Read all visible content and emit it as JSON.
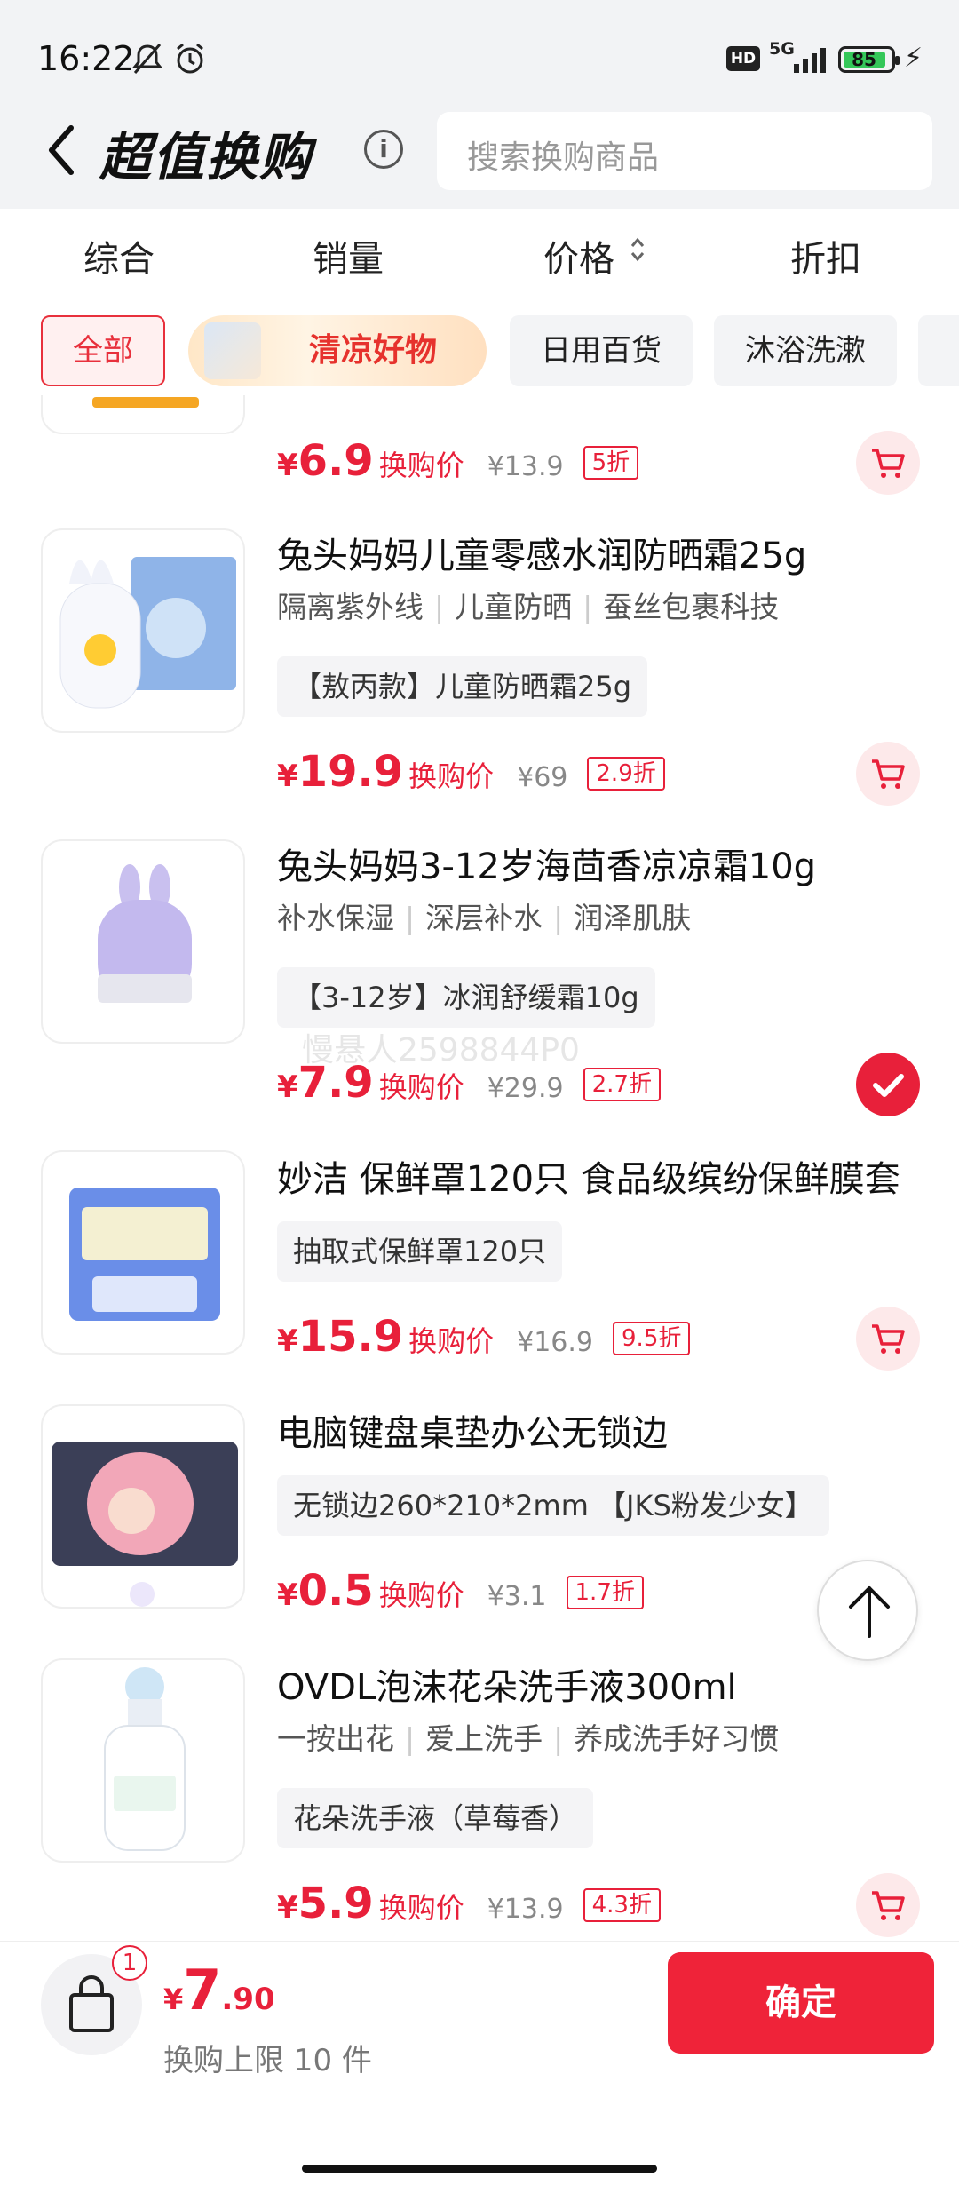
{
  "status": {
    "time": "16:22",
    "hd": "HD",
    "network": "5G",
    "battery": "85"
  },
  "header": {
    "title": "超值换购",
    "info_icon": "i",
    "search_placeholder": "搜索换购商品"
  },
  "sort_tabs": [
    "综合",
    "销量",
    "价格",
    "折扣"
  ],
  "chips": {
    "all": "全部",
    "promo": "清凉好物",
    "daily": "日用百货",
    "bath": "沐浴洗漱"
  },
  "products": [
    {
      "name": "",
      "tags": [],
      "spec": "",
      "currency": "¥",
      "price": "6.9",
      "price_label": "换购价",
      "orig": "¥13.9",
      "discount": "5折",
      "selected": false
    },
    {
      "name": "兔头妈妈儿童零感水润防晒霜25g",
      "tags": [
        "隔离紫外线",
        "儿童防晒",
        "蚕丝包裹科技"
      ],
      "spec": "【敖丙款】儿童防晒霜25g",
      "currency": "¥",
      "price": "19.9",
      "price_label": "换购价",
      "orig": "¥69",
      "discount": "2.9折",
      "selected": false
    },
    {
      "name": "兔头妈妈3-12岁海茴香凉凉霜10g",
      "tags": [
        "补水保湿",
        "深层补水",
        "润泽肌肤"
      ],
      "spec": "【3-12岁】冰润舒缓霜10g",
      "currency": "¥",
      "price": "7.9",
      "price_label": "换购价",
      "orig": "¥29.9",
      "discount": "2.7折",
      "selected": true
    },
    {
      "name": "妙洁 保鲜罩120只 食品级缤纷保鲜膜套",
      "tags": [],
      "spec": "抽取式保鲜罩120只",
      "currency": "¥",
      "price": "15.9",
      "price_label": "换购价",
      "orig": "¥16.9",
      "discount": "9.5折",
      "selected": false
    },
    {
      "name": "电脑键盘桌垫办公无锁边",
      "tags": [],
      "spec": "无锁边260*210*2mm 【JKS粉发少女】",
      "currency": "¥",
      "price": "0.5",
      "price_label": "换购价",
      "orig": "¥3.1",
      "discount": "1.7折",
      "selected": false
    },
    {
      "name": "OVDL泡沫花朵洗手液300ml",
      "tags": [
        "一按出花",
        "爱上洗手",
        "养成洗手好习惯"
      ],
      "spec": "花朵洗手液（草莓香）",
      "currency": "¥",
      "price": "5.9",
      "price_label": "换购价",
      "orig": "¥13.9",
      "discount": "4.3折",
      "selected": false
    }
  ],
  "watermark": "慢悬人2598844P0",
  "bottom": {
    "badge": "1",
    "currency": "¥",
    "total_int": "7",
    "total_dec": ".90",
    "limit": "换购上限 10 件",
    "confirm": "确定"
  }
}
